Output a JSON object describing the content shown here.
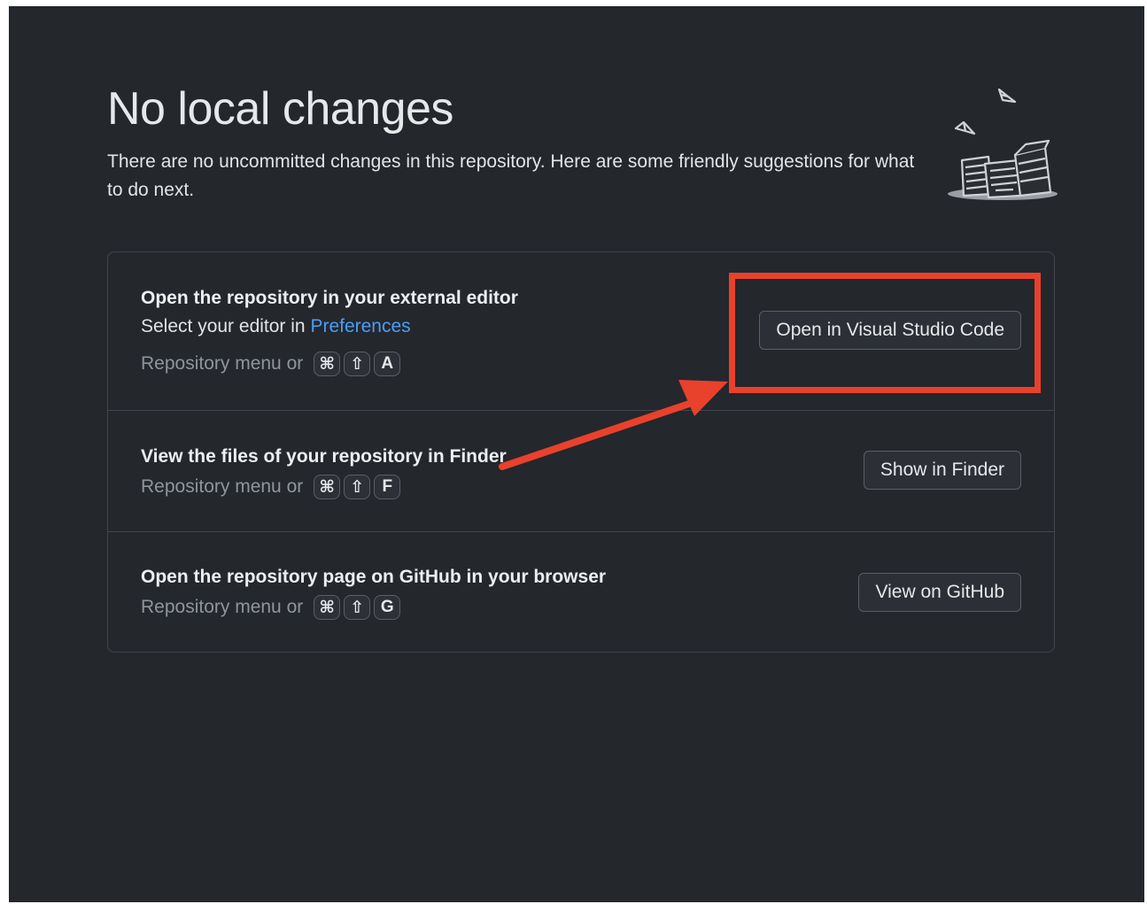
{
  "header": {
    "title": "No local changes",
    "subtitle": "There are no uncommitted changes in this repository. Here are some friendly suggestions for what to do next."
  },
  "suggestions": [
    {
      "title": "Open the repository in your external editor",
      "description_prefix": "Select your editor in ",
      "description_link": "Preferences",
      "shortcut_prefix": "Repository menu or",
      "keys": [
        "⌘",
        "⇧",
        "A"
      ],
      "button": "Open in Visual Studio Code"
    },
    {
      "title": "View the files of your repository in Finder",
      "shortcut_prefix": "Repository menu or",
      "keys": [
        "⌘",
        "⇧",
        "F"
      ],
      "button": "Show in Finder"
    },
    {
      "title": "Open the repository page on GitHub in your browser",
      "shortcut_prefix": "Repository menu or",
      "keys": [
        "⌘",
        "⇧",
        "G"
      ],
      "button": "View on GitHub"
    }
  ],
  "colors": {
    "background": "#24272c",
    "link": "#4a9cf6",
    "annotation": "#e8412c"
  },
  "icons": {
    "illustration": "paper-stack-illustration-icon",
    "command_key": "command-key-icon",
    "shift_key": "shift-key-icon"
  }
}
